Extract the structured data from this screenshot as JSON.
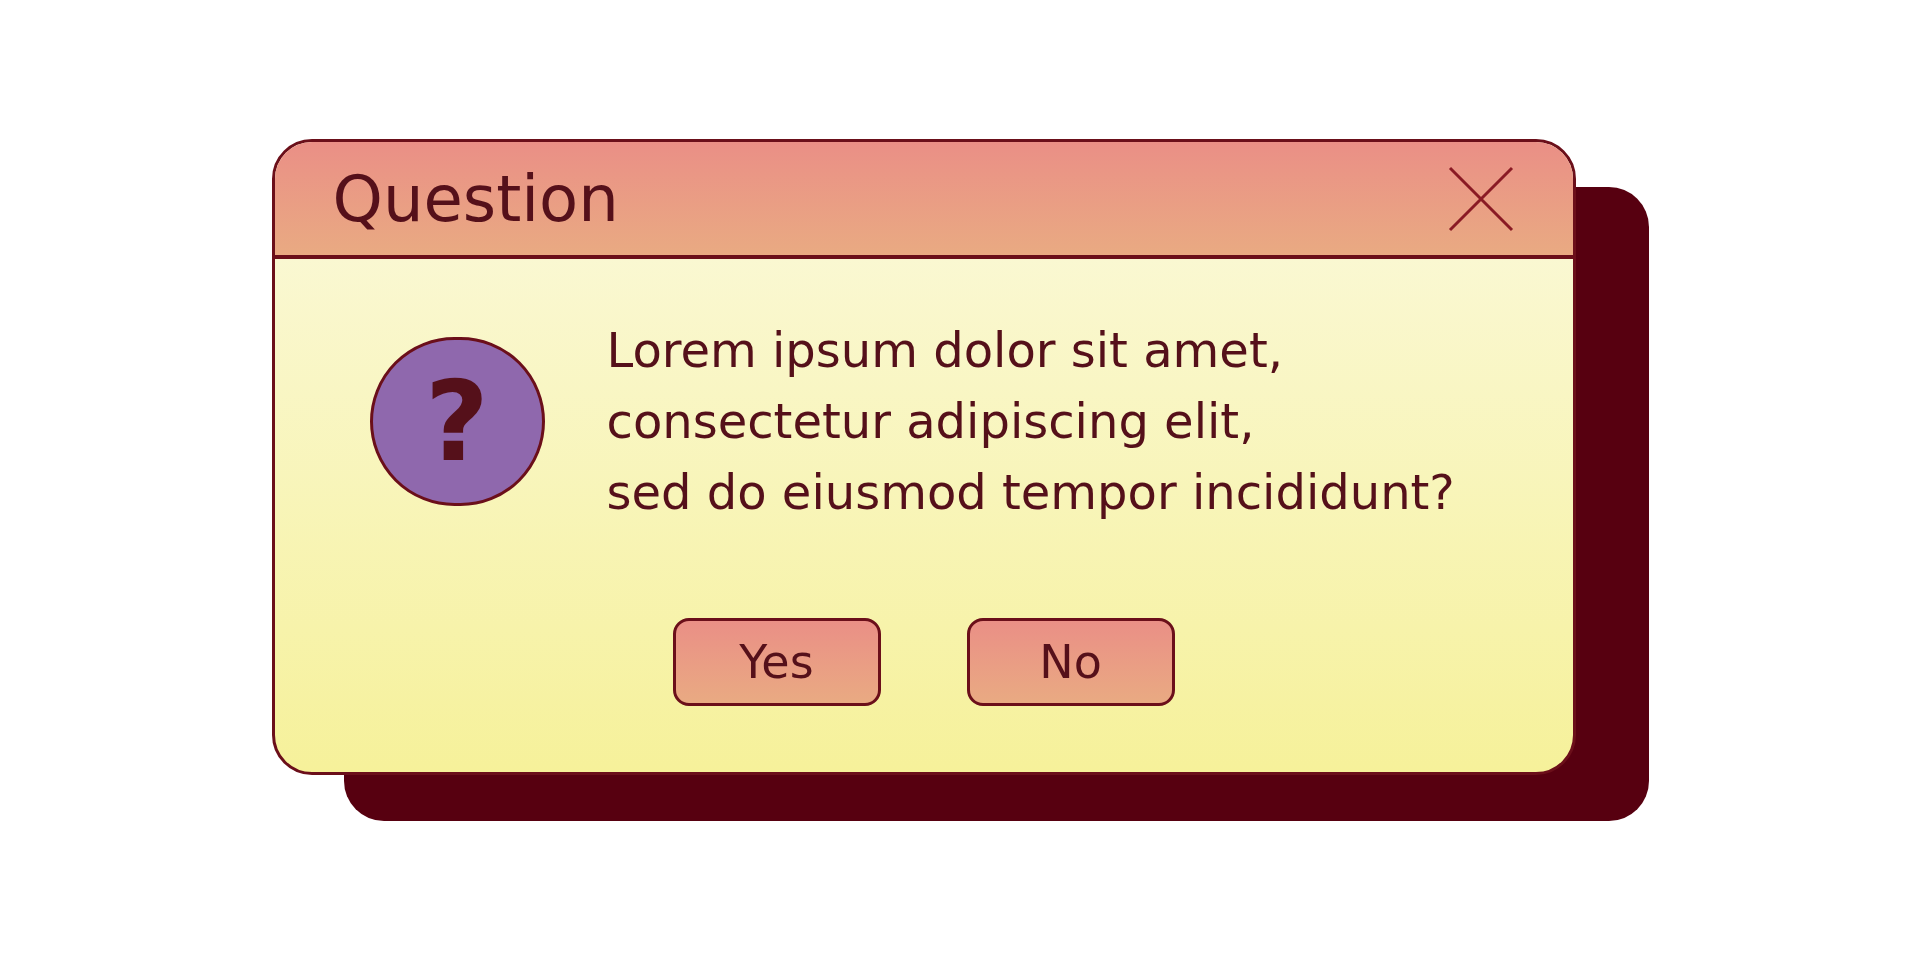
{
  "window": {
    "title": "Question"
  },
  "icon": {
    "kind": "question",
    "glyph": "?"
  },
  "message_lines": [
    "Lorem ipsum dolor sit amet,",
    "consectetur adipiscing elit,",
    "sed do eiusmod tempor incididunt?"
  ],
  "buttons": [
    {
      "label": "Yes"
    },
    {
      "label": "No"
    }
  ]
}
